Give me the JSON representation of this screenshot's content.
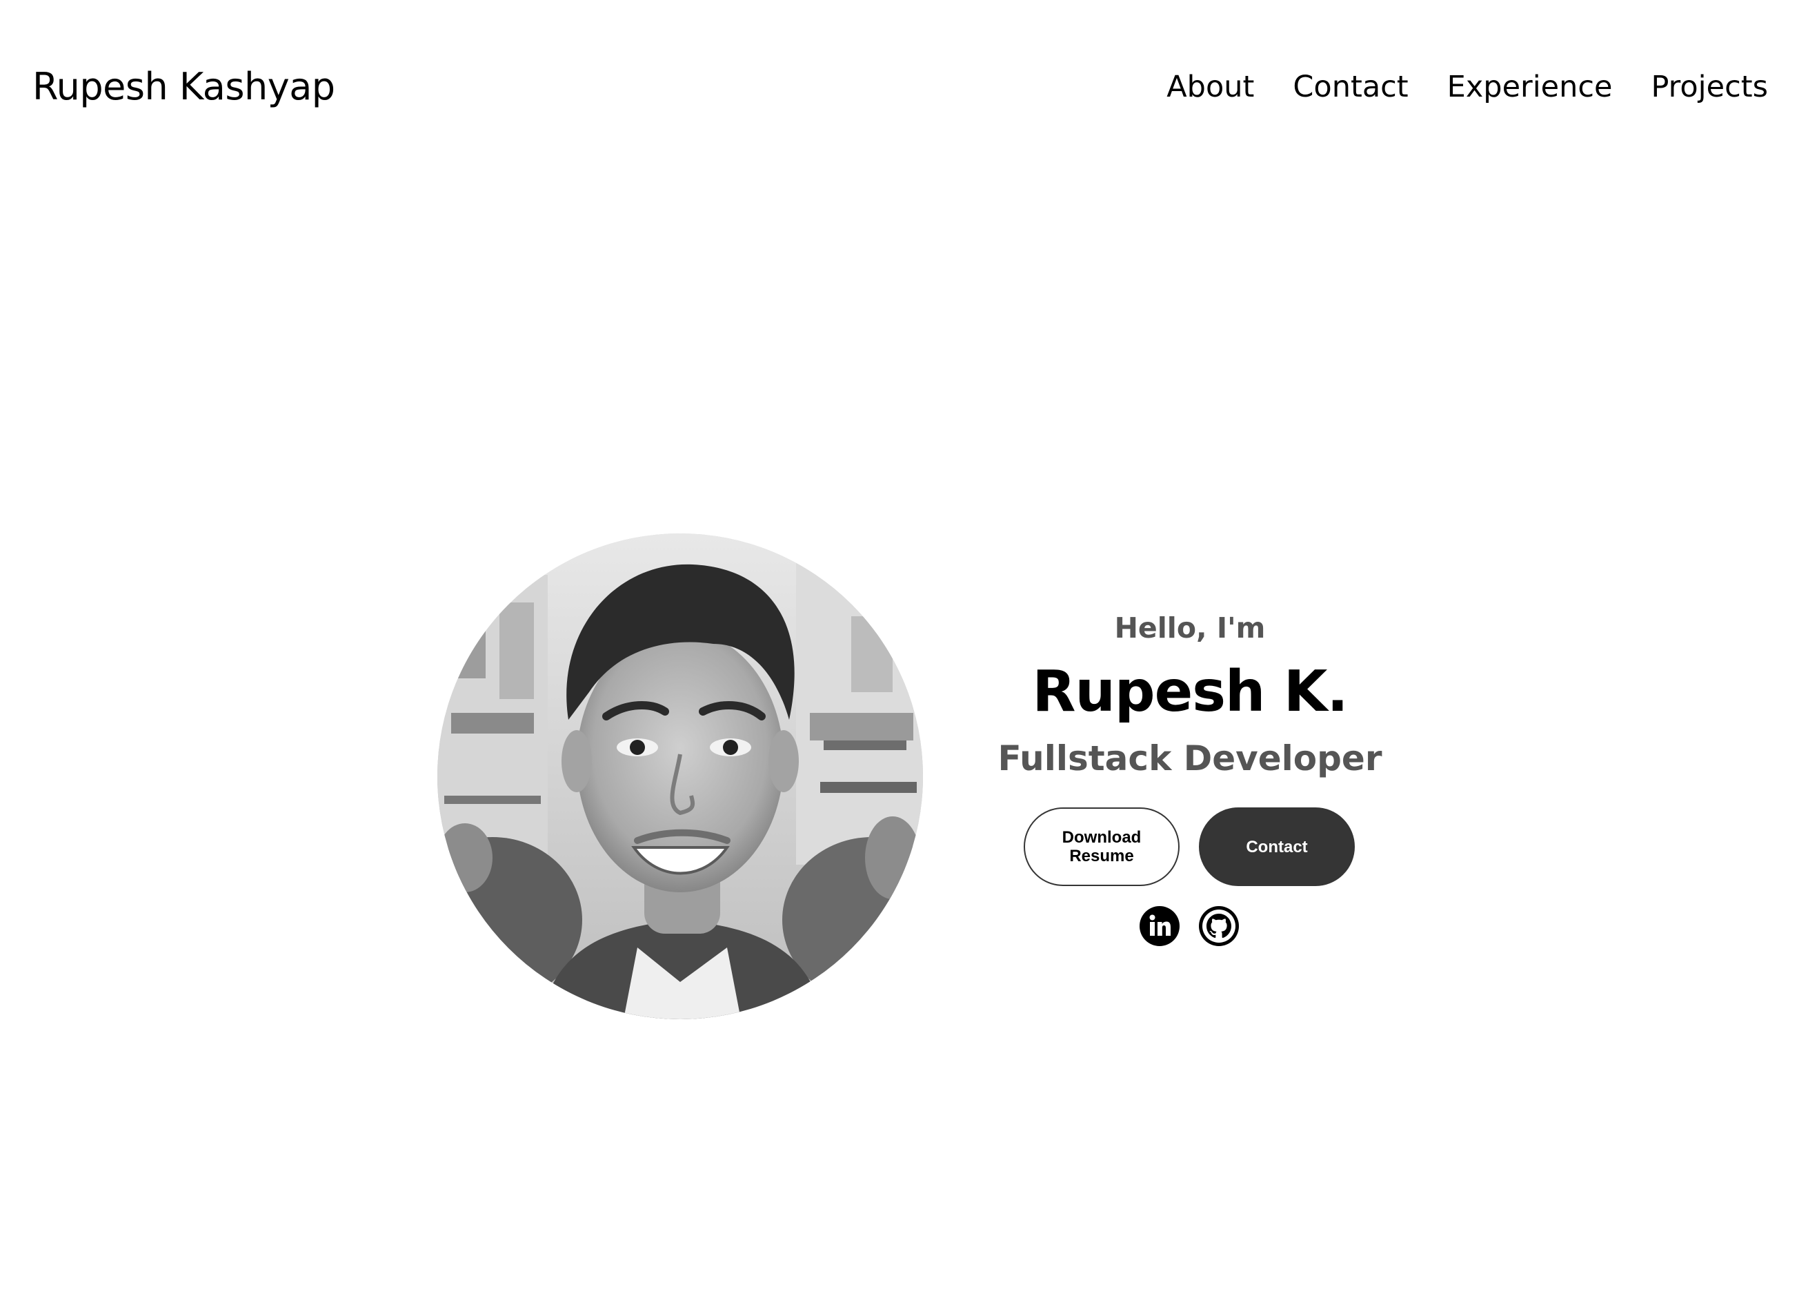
{
  "nav": {
    "brand": "Rupesh Kashyap",
    "links": [
      {
        "label": "About"
      },
      {
        "label": "Contact"
      },
      {
        "label": "Experience"
      },
      {
        "label": "Projects"
      }
    ]
  },
  "hero": {
    "greeting": "Hello, I'm",
    "name": "Rupesh K.",
    "role": "Fullstack Developer",
    "buttons": {
      "resume_label": "Download Resume",
      "contact_label": "Contact"
    },
    "socials": [
      {
        "icon": "linkedin-icon"
      },
      {
        "icon": "github-icon"
      }
    ]
  },
  "colors": {
    "background": "#ffffff",
    "text_primary": "#000000",
    "text_muted": "#555555",
    "button_dark": "#353535"
  }
}
